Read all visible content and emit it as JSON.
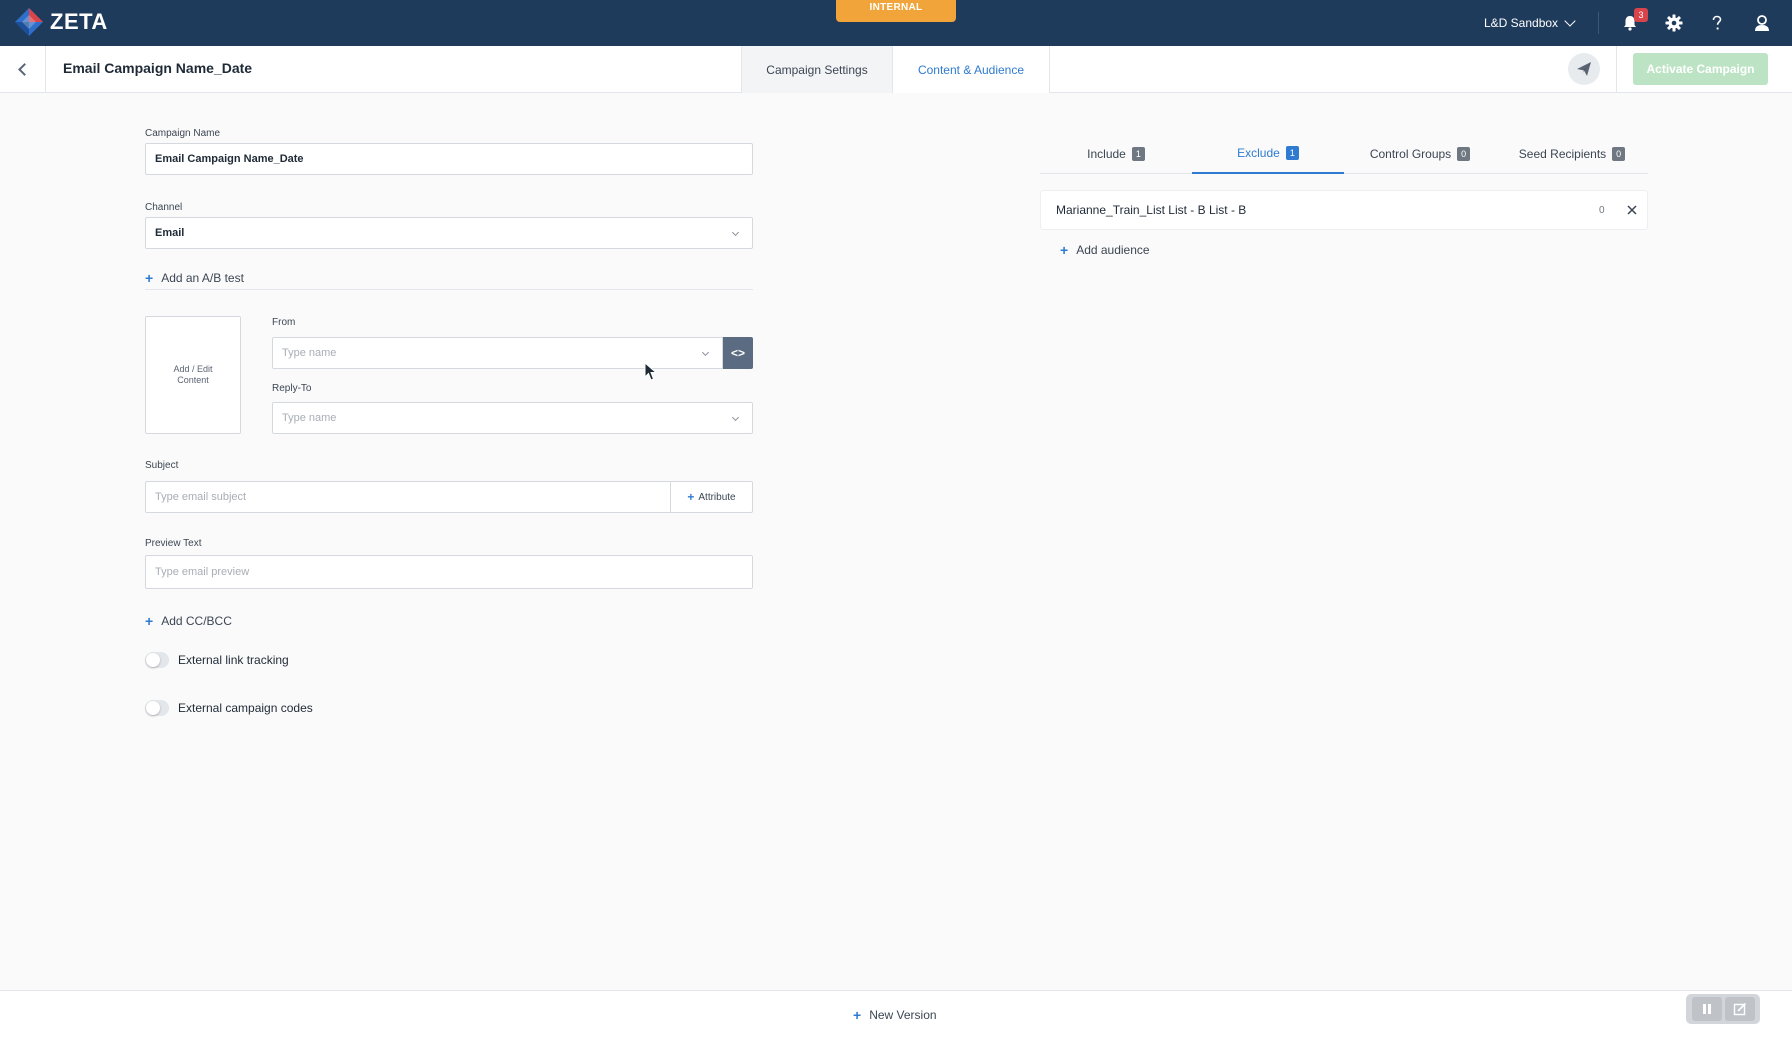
{
  "app": {
    "logo_text": "ZETA",
    "env_badge": "INTERNAL"
  },
  "topnav": {
    "workspace": "L&D Sandbox",
    "notifications_count": "3",
    "icons": [
      "bell-icon",
      "gear-icon",
      "help-icon",
      "user-icon"
    ]
  },
  "header": {
    "campaign_title": "Email Campaign Name_Date",
    "tabs": [
      {
        "label": "Campaign Settings",
        "active": false
      },
      {
        "label": "Content & Audience",
        "active": true
      }
    ],
    "activate_label": "Activate Campaign"
  },
  "form": {
    "campaign_name_label": "Campaign Name",
    "campaign_name_value": "Email Campaign Name_Date",
    "channel_label": "Channel",
    "channel_value": "Email",
    "add_ab_test": "Add an A/B test",
    "content_box_label": "Add / Edit Content",
    "from_label": "From",
    "from_placeholder": "Type name",
    "reply_to_label": "Reply-To",
    "reply_to_placeholder": "Type name",
    "subject_label": "Subject",
    "subject_placeholder": "Type email subject",
    "attribute_label": "Attribute",
    "preview_label": "Preview Text",
    "preview_placeholder": "Type email preview",
    "add_cc_bcc": "Add CC/BCC",
    "external_link_tracking": "External link tracking",
    "external_campaign_codes": "External campaign codes"
  },
  "audience": {
    "tabs": [
      {
        "label": "Include",
        "count": "1",
        "active": false
      },
      {
        "label": "Exclude",
        "count": "1",
        "active": true
      },
      {
        "label": "Control Groups",
        "count": "0",
        "active": false
      },
      {
        "label": "Seed Recipients",
        "count": "0",
        "active": false
      }
    ],
    "items": [
      {
        "name": "Marianne_Train_List List - B List - B",
        "count": "0"
      }
    ],
    "add_audience": "Add audience"
  },
  "footer": {
    "new_version": "New Version"
  },
  "colors": {
    "nav_bg": "#1f3b5c",
    "accent": "#2e7bd1",
    "badge_orange": "#f0a43a",
    "activate_disabled": "#bde3c5",
    "notif_red": "#d9434a"
  }
}
